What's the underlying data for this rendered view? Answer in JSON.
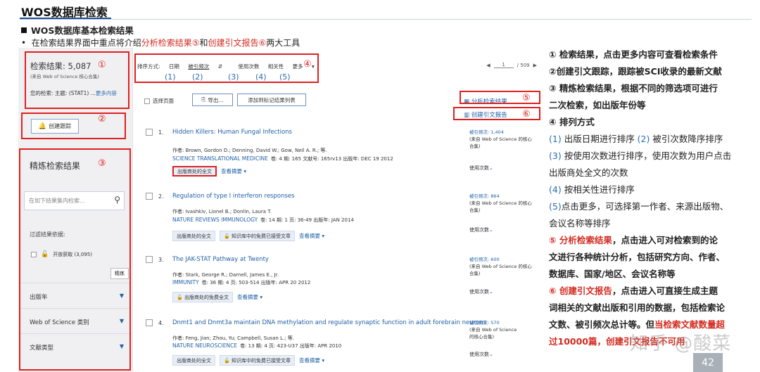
{
  "slide": {
    "title": "WOS数据库检索",
    "section": "WOS数据库基本检索结果",
    "intro_prefix": "在检索结果界面中重点将介绍",
    "intro_red1": "分析检索结果⑤",
    "intro_mid": "和",
    "intro_red2": "创建引文报告⑥",
    "intro_suffix": "两大工具"
  },
  "sidebar": {
    "results_label": "检索结果: 5,087",
    "results_source": "(来自 Web of Science 核心合集)",
    "search_label": "您的检索: 主题: (STAT1) ...",
    "search_more": "更多内容",
    "track_button": "创建跟踪",
    "refine_title": "精炼检索结果",
    "refine_placeholder": "在如下结果集内检索...",
    "filter_by": "过滤结果依据:",
    "open_access": "开放获取 (3,095)",
    "refine_button": "精炼",
    "facets": [
      "出版年",
      "Web of Science 类别",
      "文献类型"
    ],
    "marker_1": "①",
    "marker_2": "②",
    "marker_3": "③"
  },
  "sortbar": {
    "label": "排序方式:",
    "options": [
      "日期",
      "被引频次",
      "使用次数",
      "相关性",
      "更多"
    ],
    "sort_glyph": "⇵",
    "numbers": [
      "(1)",
      "(2)",
      "(3)",
      "(4)",
      "(5)"
    ],
    "marker_4": "④",
    "page_current": "1",
    "page_total": "/ 509"
  },
  "toolbar": {
    "select_page": "选择页面",
    "export": "导出...",
    "add_marked": "添加到标记结果列表",
    "analyze": "分析检索结果",
    "citation_report": "创建引文报告",
    "marker_5": "⑤",
    "marker_6": "⑥"
  },
  "records": [
    {
      "index": "1.",
      "title": "Hidden Killers: Human Fungal Infections",
      "authors": "作者: Brown, Gordon D.; Denning, David W.; Gow, Neil A. R.; 等.",
      "journal": "SCIENCE TRANSLATIONAL MEDICINE",
      "meta": "卷: 4 期: 165  文献号: 165rv13  出版年: DEC 19 2012",
      "button1": "出版商处的全文",
      "button2": "",
      "abstract": "查看摘要 ▾",
      "cites": "被引频次: 1,404",
      "cites_source": "(来自 Web of Science 的核心合集)",
      "usage": "使用次数"
    },
    {
      "index": "2.",
      "title": "Regulation of type I interferon responses",
      "authors": "作者: Ivashkiv, Lionel B.; Donlin, Laura T.",
      "journal": "NATURE REVIEWS IMMUNOLOGY",
      "meta": "卷: 14 期: 1 页: 36-49  出版年: JAN 2014",
      "button1": "出版商处的全文",
      "button2": "知识库中的免费已接受文章",
      "abstract": "查看摘要 ▾",
      "cites": "被引频次: 864",
      "cites_source": "(来自 Web of Science 的核心合集)",
      "usage": "使用次数"
    },
    {
      "index": "3.",
      "title": "The JAK-STAT Pathway at Twenty",
      "authors": "作者: Stark, George R.; Darnell, James E., Jr.",
      "journal": "IMMUNITY",
      "meta": "卷: 36 期: 4 页: 503-514  出版年: APR 20 2012",
      "button1": "出版商处的免费全文",
      "button2": "",
      "abstract": "查看摘要 ▾",
      "cites": "被引频次: 600",
      "cites_source": "(来自 Web of Science 的核心合集)",
      "usage": "使用次数"
    },
    {
      "index": "4.",
      "title": "Dnmt1 and Dnmt3a maintain DNA methylation and regulate synaptic function in adult forebrain neurons",
      "authors": "作者: Feng, Jian; Zhou, Yu; Campbell, Susan L.; 等.",
      "journal": "NATURE NEUROSCIENCE",
      "meta": "卷: 13 期: 4 页: 423-U37  出版年: APR 2010",
      "button1": "出版商处的全文",
      "button2": "知识库中的免费已接受文章",
      "abstract": "查看摘要 ▾",
      "cites": "被引频次: 570",
      "cites_source": "(来自 Web of Science 的核心合集)",
      "usage": "使用次数"
    }
  ],
  "notes": {
    "n1_a": "① 检索结果，点击更多内容可查看检索条件",
    "n2_a": "②创建引文跟踪，跟踪被SCI收录的最新文献",
    "n3_a": "③ 精炼检索结果，根据不同的筛选项可进行",
    "n3_b": "二次检索，如出版年份等",
    "n4_a": "④ 排列方式",
    "n4_b1": "(1)",
    "n4_b2": " 出版日期进行排序  ",
    "n4_b3": "(2)",
    "n4_b4": " 被引次数降序排序",
    "n4_c1": "(3)",
    "n4_c2": " 按使用次数进行排序，使用次数为用户点击",
    "n4_d": "出版商处全文的次数",
    "n4_e1": "(4)",
    "n4_e2": " 按相关性进行排序",
    "n4_f1": "(5)",
    "n4_f2": "点击更多，可选择第一作者、来源出版物、",
    "n4_g": "会议名称等排序",
    "n5_red": "⑤ 分析检索结果",
    "n5_a": "，点击进入可对检索到的论",
    "n5_b": "文进行各种统计分析，包括研究方向、作者、",
    "n5_c": "数据库、国家/地区、会议名称等",
    "n6_red": "⑥ 创建引文报告",
    "n6_a": "，点击进入可直接生成主题",
    "n6_b": "词相关的文献出版和引用的数据，包括检索论",
    "n6_c": "文数、被引频次总计等。但",
    "n6_c_red": "当检索文献数量超",
    "n6_d_red": "过10000篇，创建引文报告不可用"
  },
  "watermark": "知乎 @酸菜",
  "page_number": "42",
  "colors": {
    "accent_red": "#d42a1f",
    "box_red": "#e02020",
    "link_blue": "#1f5fa6",
    "title_rule": "#1e4a8c"
  }
}
